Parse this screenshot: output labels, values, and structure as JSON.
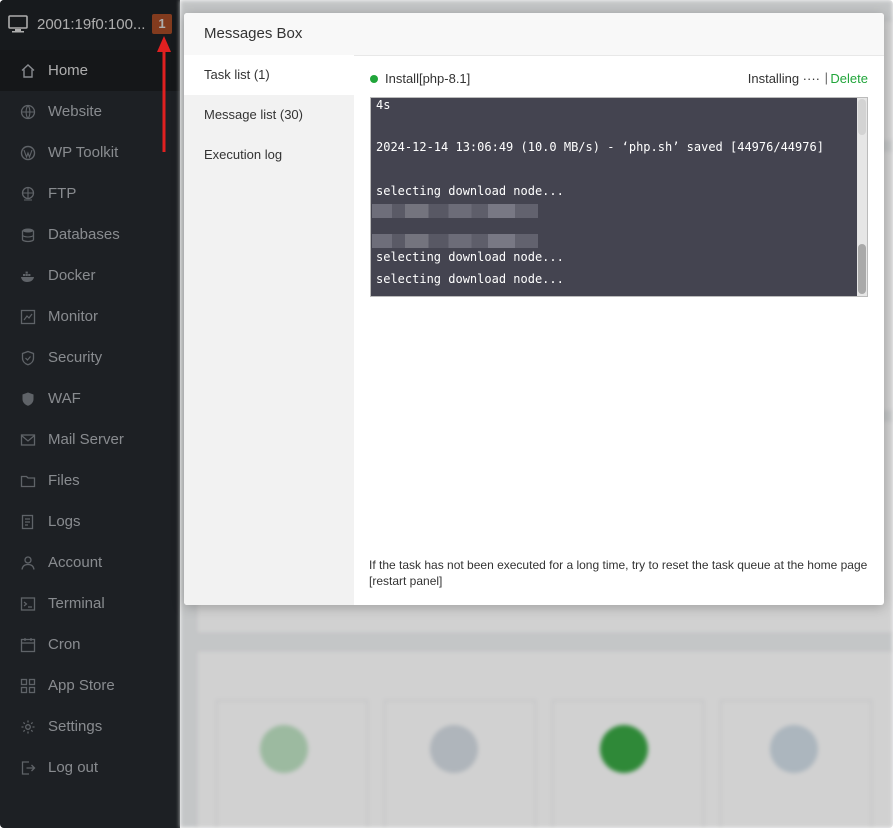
{
  "sidebar": {
    "host": "2001:19f0:100...",
    "badge": "1",
    "items": [
      {
        "label": "Home",
        "icon": "home-icon",
        "active": true
      },
      {
        "label": "Website",
        "icon": "globe-icon"
      },
      {
        "label": "WP Toolkit",
        "icon": "wordpress-icon"
      },
      {
        "label": "FTP",
        "icon": "ftp-icon"
      },
      {
        "label": "Databases",
        "icon": "database-icon"
      },
      {
        "label": "Docker",
        "icon": "docker-icon"
      },
      {
        "label": "Monitor",
        "icon": "monitor-chart-icon"
      },
      {
        "label": "Security",
        "icon": "shield-icon"
      },
      {
        "label": "WAF",
        "icon": "waf-shield-icon"
      },
      {
        "label": "Mail Server",
        "icon": "mail-icon"
      },
      {
        "label": "Files",
        "icon": "folder-icon"
      },
      {
        "label": "Logs",
        "icon": "logs-icon"
      },
      {
        "label": "Account",
        "icon": "user-icon"
      },
      {
        "label": "Terminal",
        "icon": "terminal-icon"
      },
      {
        "label": "Cron",
        "icon": "clock-icon"
      },
      {
        "label": "App Store",
        "icon": "apps-icon"
      },
      {
        "label": "Settings",
        "icon": "gear-icon"
      },
      {
        "label": "Log out",
        "icon": "logout-icon"
      }
    ]
  },
  "modal": {
    "title": "Messages Box",
    "tabs": [
      {
        "label": "Task list (1)",
        "active": true
      },
      {
        "label": "Message list (30)"
      },
      {
        "label": "Execution log"
      }
    ],
    "task": {
      "name": "Install[php-8.1]",
      "status": "Installing ····",
      "separator": "|",
      "delete_label": "Delete"
    },
    "log_lines": [
      "4s",
      "",
      "2024-12-14 13:06:49 (10.0 MB/s) - ‘php.sh’ saved [44976/44976]",
      "",
      "selecting download node...",
      "",
      "",
      "selecting download node...",
      "selecting download node..."
    ],
    "hint": "If the task has not been executed for a long time, try to reset the task queue at the home page [restart panel]"
  },
  "colors": {
    "sidebar_bg": "#2c3036",
    "accent_green": "#20a53a",
    "badge": "#c0582d",
    "arrow": "#e02020",
    "terminal_bg": "#444450"
  }
}
